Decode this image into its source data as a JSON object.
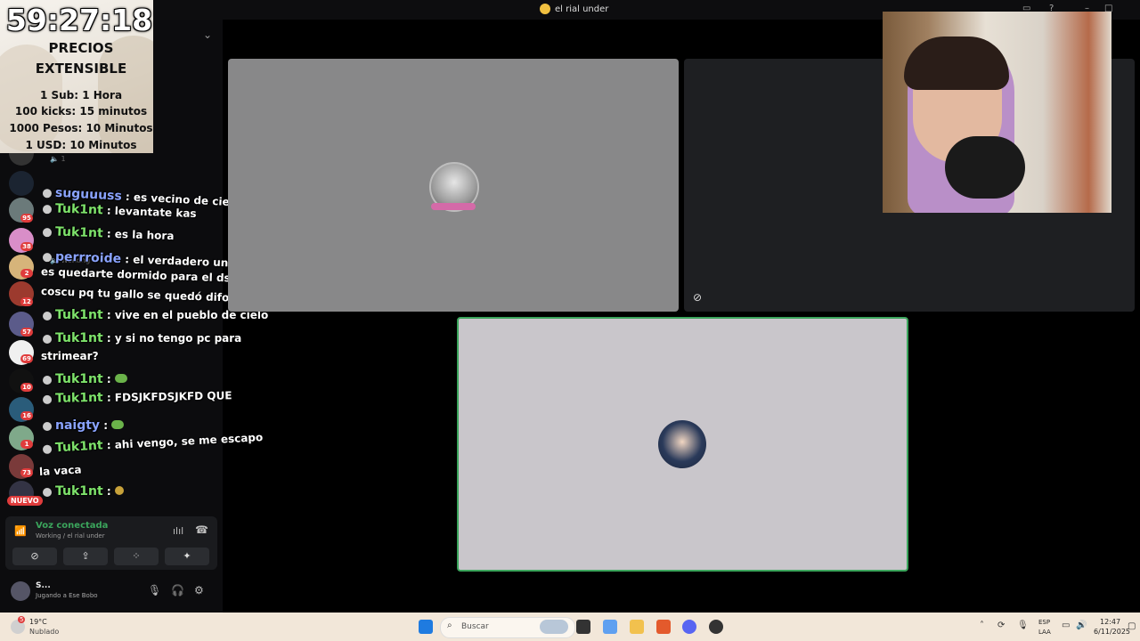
{
  "window": {
    "title": "el rial under"
  },
  "timer_overlay": {
    "time": "59:27:18",
    "heading_line1": "PRECIOS",
    "heading_line2": "EXTENSIBLE",
    "prices": [
      "1 Sub: 1 Hora",
      "100 kicks: 15 minutos",
      "1000 Pesos: 10 Minutos",
      "1 USD: 10 Minutos"
    ]
  },
  "servers": {
    "badges": [
      "95",
      "38",
      "2",
      "12",
      "57",
      "69",
      "10",
      "16",
      "1",
      "73"
    ],
    "new_label": "NUEVO"
  },
  "channel_bg": {
    "member_count": "1",
    "working_label": "Working"
  },
  "chat": [
    {
      "user": "suguuuss",
      "text": ": es vecino de cielo"
    },
    {
      "user": "Tuk1nt",
      "text": ": levantate kas"
    },
    {
      "user": "Tuk1nt",
      "text": ": es la hora"
    },
    {
      "user": "perrroide",
      "text": ": el verdadero under"
    },
    {
      "user": "",
      "text": "es quedarte dormido para el ds con"
    },
    {
      "user": "",
      "text": "coscu pq tu gallo se quedó difonico"
    },
    {
      "user": "Tuk1nt",
      "text": ": vive en el pueblo de cielo"
    },
    {
      "user": "Tuk1nt",
      "text": ": y si no tengo pc para"
    },
    {
      "user": "",
      "text": "strimear?"
    },
    {
      "user": "Tuk1nt",
      "text": ":"
    },
    {
      "user": "Tuk1nt",
      "text": ": FDSJKFDSJKFD QUE"
    },
    {
      "user": "naigty",
      "text": ":"
    },
    {
      "user": "Tuk1nt",
      "text": ": ahi vengo, se me escapo"
    },
    {
      "user": "",
      "text": "la vaca"
    },
    {
      "user": "Tuk1nt",
      "text": ":"
    }
  ],
  "voice_panel": {
    "status": "Voz conectada",
    "channel": "Working / el rial under"
  },
  "user_panel": {
    "name": "S...",
    "activity": "Jugando a Ese Bobo"
  },
  "taskbar": {
    "weather_temp": "19°C",
    "weather_desc": "Nublado",
    "weather_badge": "5",
    "search_placeholder": "Buscar",
    "lang_line1": "ESP",
    "lang_line2": "LAA",
    "time": "12:47",
    "date": "6/11/2025"
  },
  "colors": {
    "accent_green": "#3ba55c",
    "chat_nick": "#7ee36b",
    "badge_red": "#e03c3c"
  }
}
